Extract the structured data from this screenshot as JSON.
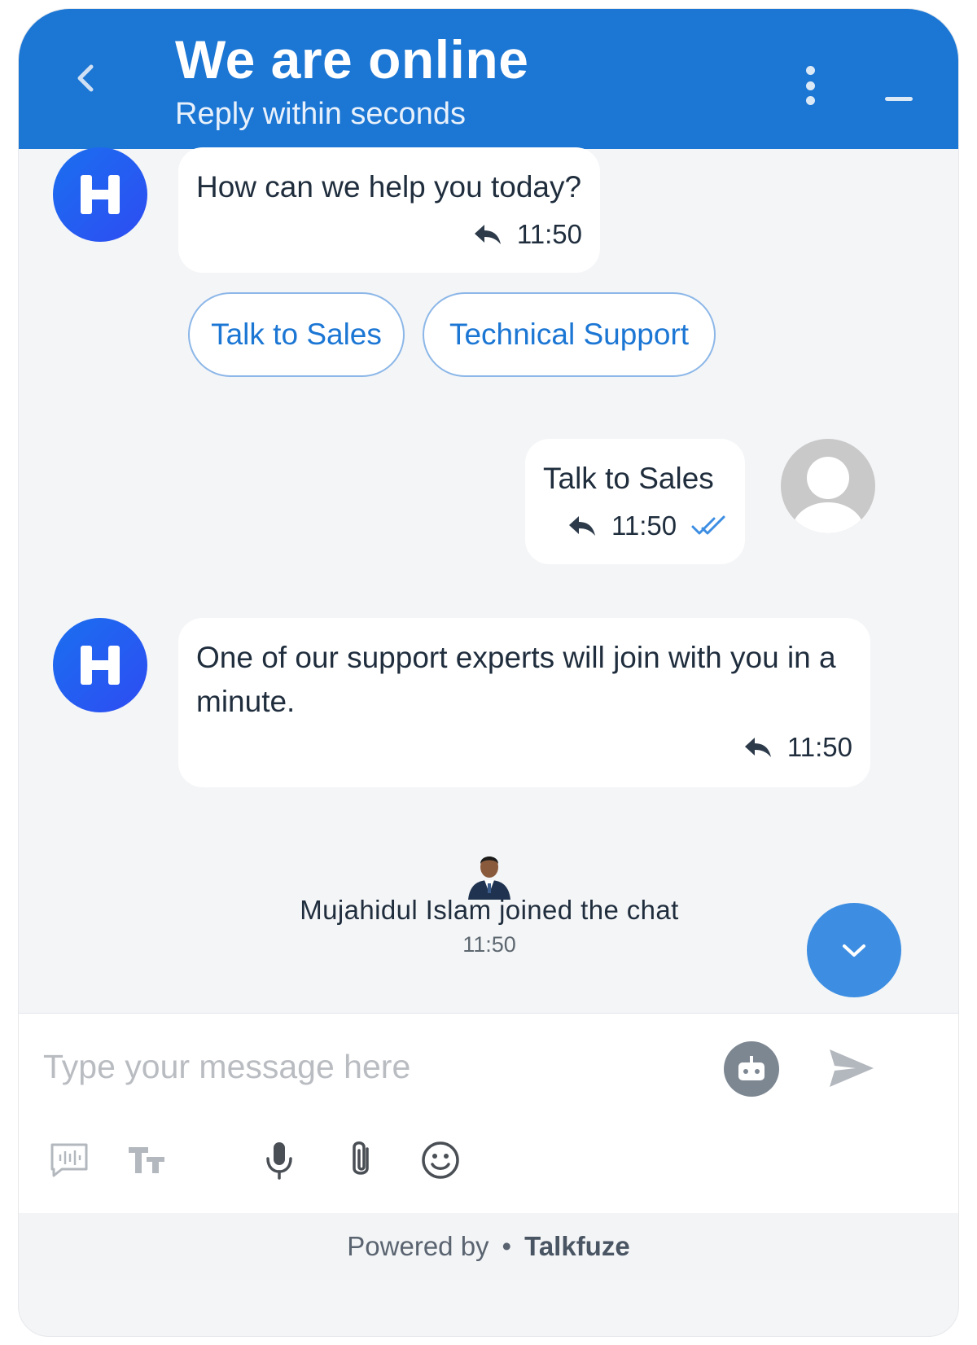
{
  "header": {
    "title": "We are online",
    "subtitle": "Reply within seconds"
  },
  "messages": {
    "m1": {
      "text": "How can we help you today?",
      "time": "11:50"
    },
    "m2": {
      "text": "Talk to Sales",
      "time": "11:50"
    },
    "m3": {
      "text": "One of our support experts will join with you in a minute.",
      "time": "11:50"
    }
  },
  "quick_replies": [
    "Talk to Sales",
    "Technical Support"
  ],
  "system_event": {
    "text": "Mujahidul Islam joined the chat",
    "time": "11:50"
  },
  "composer": {
    "placeholder": "Type your message here"
  },
  "footer": {
    "prefix": "Powered by",
    "separator": "•",
    "brand": "Talkfuze"
  },
  "colors": {
    "header": "#1b76d4",
    "accent": "#3d8ee2",
    "bubble": "#ffffff",
    "background": "#f4f5f7"
  },
  "icons": [
    "back-arrow-icon",
    "more-vertical-icon",
    "minimize-icon",
    "reply-icon",
    "double-check-icon",
    "chevron-down-icon",
    "bot-icon",
    "send-icon",
    "voice-message-icon",
    "text-format-icon",
    "microphone-icon",
    "attachment-icon",
    "emoji-icon"
  ]
}
